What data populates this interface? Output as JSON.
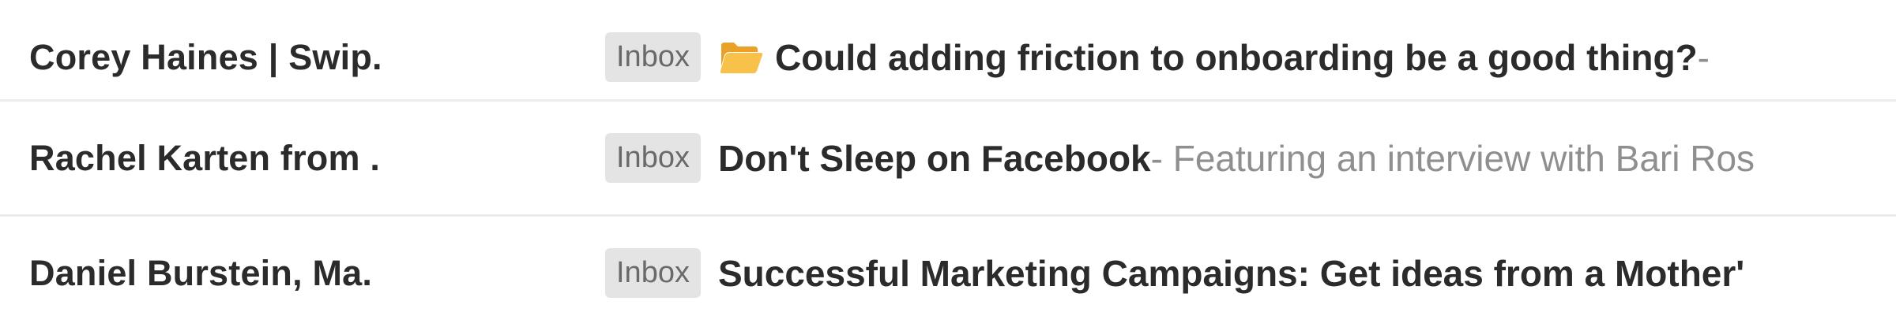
{
  "messages": [
    {
      "sender": "Corey Haines | Swip.",
      "label": "Inbox",
      "emoji": "open-folder-icon",
      "subject": "Could adding friction to onboarding be a good thing?",
      "snippet": " -"
    },
    {
      "sender": "Rachel Karten from .",
      "label": "Inbox",
      "subject": "Don't Sleep on Facebook",
      "snippet": " - Featuring an interview with Bari Ros"
    },
    {
      "sender": "Daniel Burstein, Ma.",
      "label": "Inbox",
      "subject": "Successful Marketing Campaigns: Get ideas from a Mother'",
      "snippet": ""
    }
  ],
  "colors": {
    "label_bg": "#e4e4e4",
    "label_text": "#6a6a6a",
    "sender_text": "#2b2b2b",
    "snippet_text": "#8f8f8f",
    "divider": "#ececec",
    "folder_yellow": "#f5b83d"
  }
}
